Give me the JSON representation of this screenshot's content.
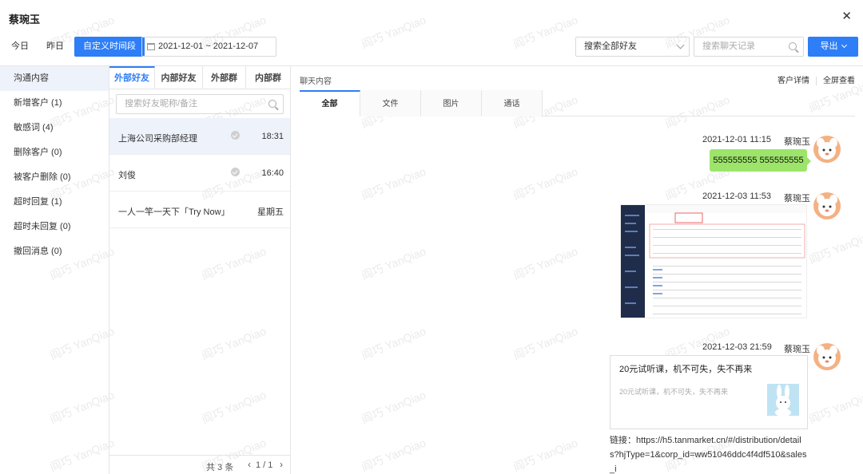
{
  "title": "蔡琬玉",
  "toolbar": {
    "today": "今日",
    "yesterday": "昨日",
    "custom": "自定义时间段",
    "date_range": "2021-12-01 ~ 2021-12-07",
    "friend_select": "搜索全部好友",
    "search_placeholder": "搜索聊天记录",
    "export": "导出"
  },
  "left_menu": [
    {
      "label": "沟通内容"
    },
    {
      "label": "新增客户 (1)"
    },
    {
      "label": "敏感词 (4)"
    },
    {
      "label": "删除客户 (0)"
    },
    {
      "label": "被客户删除 (0)"
    },
    {
      "label": "超时回复 (1)"
    },
    {
      "label": "超时未回复 (0)"
    },
    {
      "label": "撤回消息 (0)"
    }
  ],
  "mid": {
    "tabs": [
      "外部好友",
      "内部好友",
      "外部群",
      "内部群"
    ],
    "search_placeholder": "搜索好友昵称/备注",
    "contacts": [
      {
        "name": "上海公司采购部经理",
        "time": "18:31"
      },
      {
        "name": "刘俊",
        "time": "16:40"
      },
      {
        "name": "一人一竿一天下「Try Now」",
        "time": "星期五"
      }
    ],
    "total": "共 3 条",
    "page": "1 / 1"
  },
  "chat": {
    "title": "聊天内容",
    "detail_link": "客户详情",
    "fullscreen_link": "全屏查看",
    "tabs": [
      "全部",
      "文件",
      "图片",
      "通话"
    ],
    "messages": [
      {
        "time": "2021-12-01 11:15",
        "sender": "蔡琬玉",
        "text": "555555555 555555555"
      },
      {
        "time": "2021-12-03 11:53",
        "sender": "蔡琬玉"
      },
      {
        "time": "2021-12-03 21:59",
        "sender": "蔡琬玉",
        "card_title": "20元试听课，机不可失，失不再来",
        "card_desc": "20元试听课，机不可失，失不再来",
        "link": "链接：https://h5.tanmarket.cn/#/distribution/details?hjType=1&corp_id=ww51046ddc4f4df510&sales_i"
      }
    ]
  },
  "watermark": "阎巧 YanQiao",
  "colors": {
    "accent": "#2d7ef7",
    "bubble": "#9de56a"
  }
}
